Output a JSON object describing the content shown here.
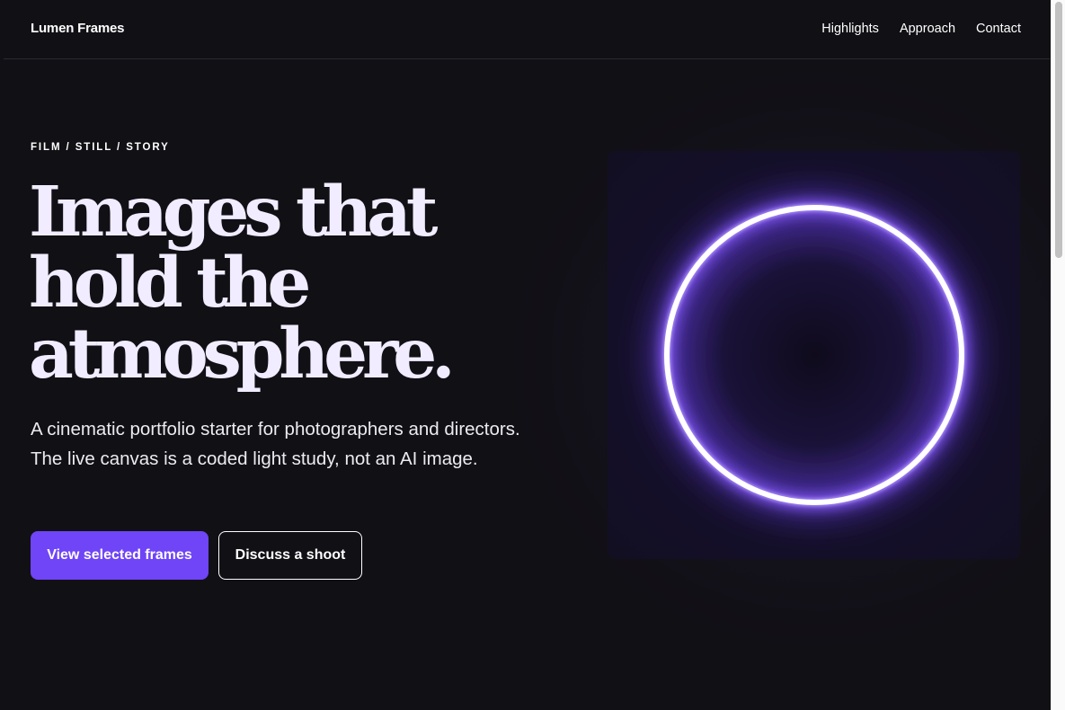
{
  "header": {
    "brand": "Lumen Frames",
    "nav": [
      {
        "label": "Highlights"
      },
      {
        "label": "Approach"
      },
      {
        "label": "Contact"
      }
    ]
  },
  "hero": {
    "eyebrow": "FILM / STILL / STORY",
    "headline_lines": [
      "Images that",
      "hold the",
      "atmosphere."
    ],
    "lede": "A cinematic portfolio starter for photographers and directors. The live canvas is a coded light study, not an AI image.",
    "primary_cta": "View selected frames",
    "secondary_cta": "Discuss a shoot"
  },
  "visual": {
    "name": "glowing-ring",
    "ring_color": "#8a5cff",
    "ring_core_color": "#ffffff"
  },
  "colors": {
    "background": "#111015",
    "accent": "#6f45f7",
    "headline": "#f1ecff",
    "text": "#ffffff"
  }
}
